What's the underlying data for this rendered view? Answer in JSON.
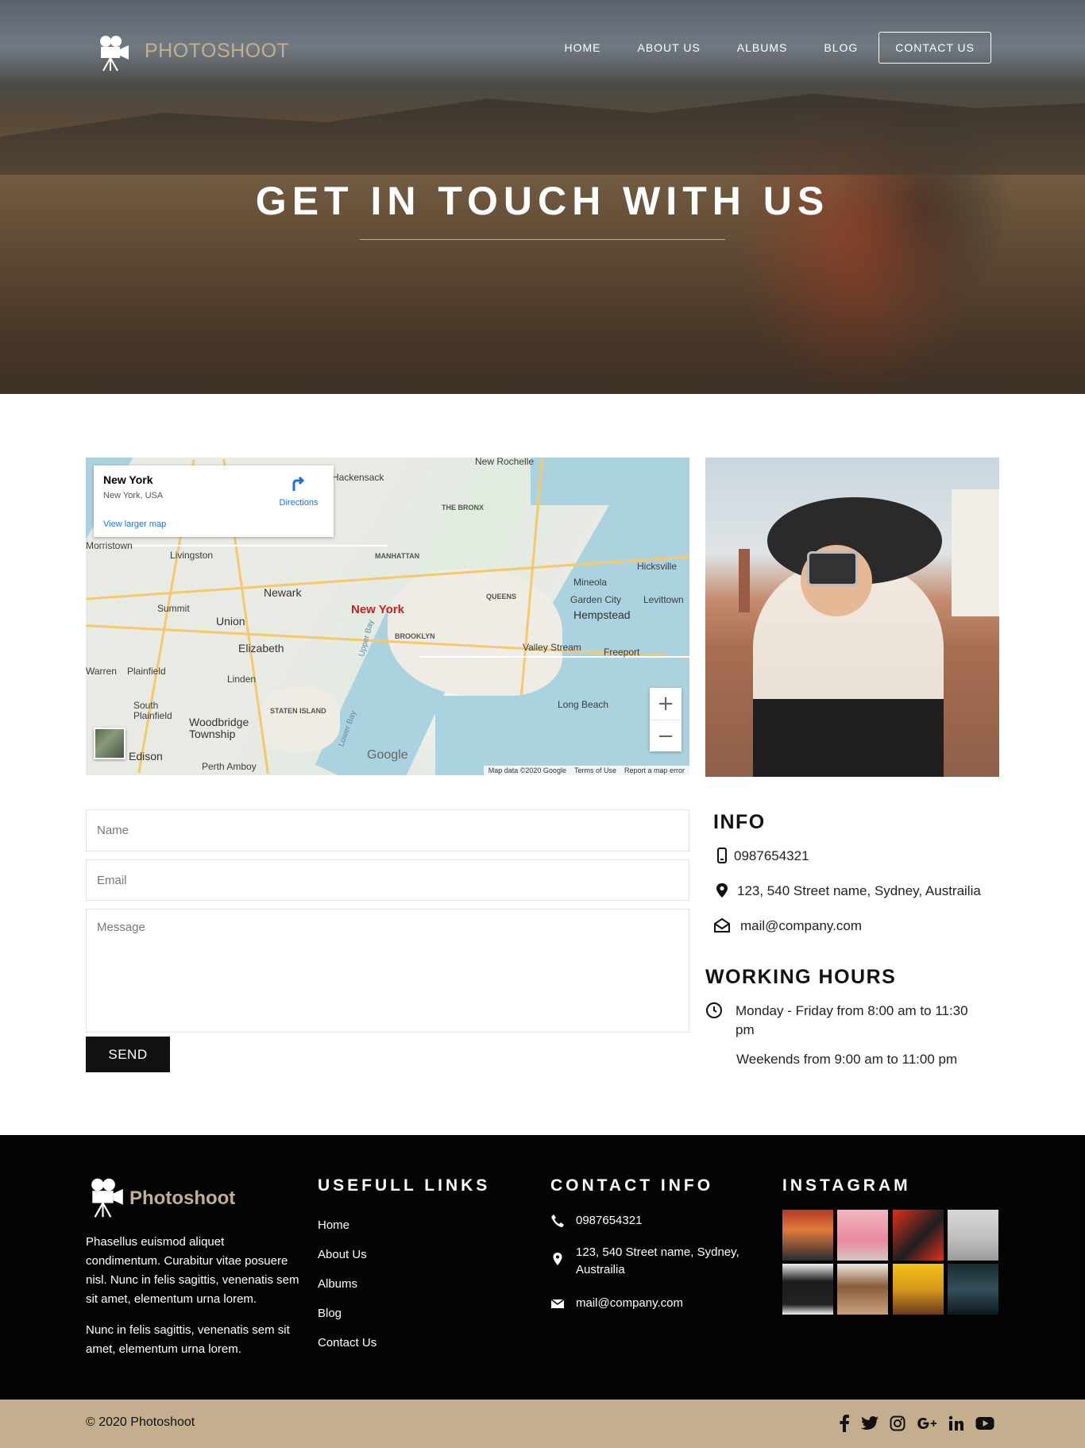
{
  "brand": {
    "name": "PHOTOSHOOT",
    "accent": "#c4ae8d"
  },
  "nav": {
    "items": [
      "HOME",
      "ABOUT US",
      "ALBUMS",
      "BLOG",
      "CONTACT US"
    ],
    "active": "CONTACT US"
  },
  "hero": {
    "title": "GET IN TOUCH WITH US"
  },
  "map": {
    "card": {
      "title": "New York",
      "subtitle": "New York, USA",
      "directions": "Directions",
      "larger_map": "View larger map"
    },
    "labels": {
      "new_rochelle": "New Rochelle",
      "hackensack": "Hackensack",
      "the_bronx": "THE BRONX",
      "manhattan": "MANHATTAN",
      "queens": "QUEENS",
      "brooklyn": "BROOKLYN",
      "new_york": "New York",
      "newark": "Newark",
      "union": "Union",
      "elizabeth": "Elizabeth",
      "summit": "Summit",
      "livingston": "Livingston",
      "morristown": "Morristown",
      "plainfield": "Plainfield",
      "linden": "Linden",
      "staten_island": "STATEN ISLAND",
      "woodbridge": "Woodbridge\nTownship",
      "south_plainfield": "South\nPlainfield",
      "edison": "Edison",
      "perth_amboy": "Perth Amboy",
      "hicksville": "Hicksville",
      "mineola": "Mineola",
      "garden_city": "Garden City",
      "levittown": "Levittown",
      "hempstead": "Hempstead",
      "valley_stream": "Valley Stream",
      "freeport": "Freeport",
      "long_beach": "Long Beach",
      "upper_bay": "Upper Bay",
      "lower_bay": "Lower Bay",
      "warren": "Warren"
    },
    "google": "Google",
    "attribution": [
      "Map data ©2020 Google",
      "Terms of Use",
      "Report a map error"
    ],
    "zoom_in": "+",
    "zoom_out": "−"
  },
  "form": {
    "name_placeholder": "Name",
    "email_placeholder": "Email",
    "message_placeholder": "Message",
    "send_label": "SEND"
  },
  "info": {
    "title": "INFO",
    "phone": "0987654321",
    "address": "123, 540 Street name, Sydney, Austrailia",
    "email": "mail@company.com",
    "hours_title": "WORKING HOURS",
    "weekdays": "Monday - Friday from 8:00 am to 11:30 pm",
    "weekends": "Weekends from 9:00 am to 11:00 pm"
  },
  "footer": {
    "brand": "Photoshoot",
    "para1": "Phasellus euismod aliquet condimentum. Curabitur vitae posuere nisl. Nunc in felis sagittis, venenatis sem sit amet, elementum urna lorem.",
    "para2": "Nunc in felis sagittis, venenatis sem sit amet, elementum urna lorem.",
    "links_title": "USEFULL LINKS",
    "links": [
      "Home",
      "About Us",
      "Albums",
      "Blog",
      "Contact Us"
    ],
    "contact_title": "CONTACT INFO",
    "contact": {
      "phone": "0987654321",
      "address": "123, 540 Street name, Sydney, Austrailia",
      "email": "mail@company.com"
    },
    "instagram_title": "INSTAGRAM",
    "copyright": "© 2020 Photoshoot",
    "social_icons": [
      "facebook-icon",
      "twitter-icon",
      "instagram-icon",
      "google-plus-icon",
      "linkedin-icon",
      "youtube-icon"
    ]
  }
}
